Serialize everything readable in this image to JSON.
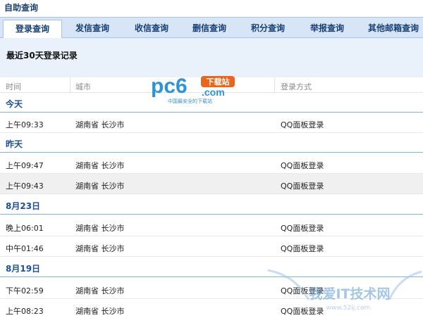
{
  "page": {
    "title": "自助查询"
  },
  "tabs": [
    {
      "label": "登录查询",
      "active": true
    },
    {
      "label": "发信查询"
    },
    {
      "label": "收信查询"
    },
    {
      "label": "删信查询"
    },
    {
      "label": "积分查询"
    },
    {
      "label": "举报查询"
    },
    {
      "label": "其他邮箱查询"
    }
  ],
  "panel": {
    "title": "最近30天登录记录"
  },
  "columns": {
    "time": "时间",
    "city": "城市",
    "method": "登录方式"
  },
  "groups": [
    {
      "label": "今天",
      "rows": [
        {
          "time": "上午09:33",
          "city": "湖南省 长沙市",
          "method": "QQ面板登录"
        }
      ]
    },
    {
      "label": "昨天",
      "rows": [
        {
          "time": "上午09:47",
          "city": "湖南省 长沙市",
          "method": "QQ面板登录"
        },
        {
          "time": "上午09:43",
          "city": "湖南省 长沙市",
          "method": "QQ面板登录",
          "highlight": true
        }
      ]
    },
    {
      "label": "8月23日",
      "rows": [
        {
          "time": "晚上06:01",
          "city": "湖南省 长沙市",
          "method": "QQ面板登录"
        },
        {
          "time": "中午01:46",
          "city": "湖南省 长沙市",
          "method": "QQ面板登录"
        }
      ]
    },
    {
      "label": "8月19日",
      "rows": [
        {
          "time": "下午02:59",
          "city": "湖南省 长沙市",
          "method": "QQ面板登录"
        },
        {
          "time": "上午08:23",
          "city": "湖南省 长沙市",
          "method": "QQ面板登录"
        }
      ]
    }
  ],
  "watermark": {
    "logo_text": "pc6",
    "logo_badge": "下载站",
    "logo_com": ".com",
    "logo_slogan": "中国最安全的下载站",
    "site_text": "我爱IT技术网",
    "site_url": "www.52ij.com"
  },
  "colors": {
    "accent": "#1d4f96",
    "tab_bar": "#d7e5f6",
    "panel": "#e9f1fb",
    "group_line": "#7fb0e0"
  }
}
